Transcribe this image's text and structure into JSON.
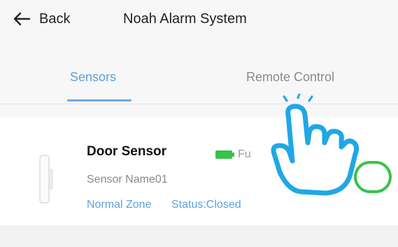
{
  "header": {
    "back_label": "Back",
    "title": "Noah Alarm System"
  },
  "tabs": [
    {
      "label": "Sensors",
      "active": true
    },
    {
      "label": "Remote Control",
      "active": false
    }
  ],
  "sensor": {
    "name": "Door Sensor",
    "battery_text": "Fu",
    "sensor_name": "Sensor Name01",
    "zone": "Normal Zone",
    "status": "Status:Closed",
    "enabled": true
  },
  "colors": {
    "accent_blue": "#5ea0e0",
    "toggle_green": "#38c24a",
    "hand_blue": "#1fa7e6"
  }
}
